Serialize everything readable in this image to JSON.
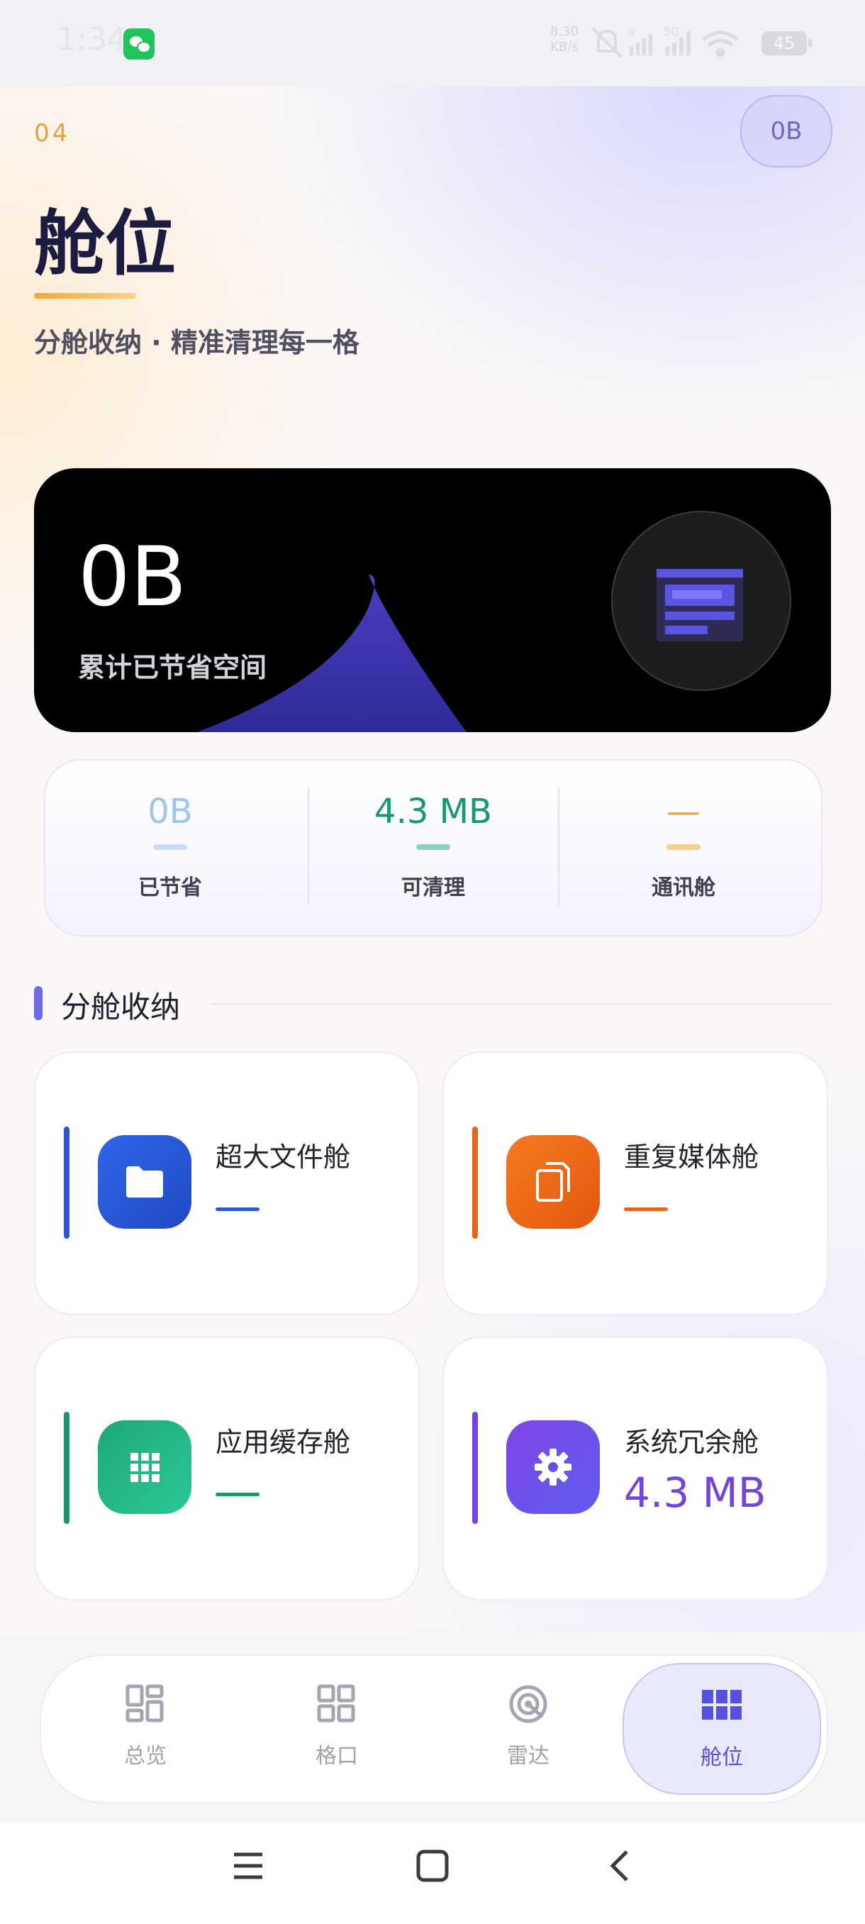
{
  "status_bar": {
    "time": "1:34",
    "net_speed_value": "8.30",
    "net_speed_unit": "KB/s",
    "network_label": "5G",
    "battery": "45"
  },
  "header": {
    "number": "04",
    "badge": "0B",
    "title": "舱位",
    "subtitle": "分舱收纳 · 精准清理每一格"
  },
  "hero": {
    "value": "0B",
    "label": "累计已节省空间"
  },
  "stats": [
    {
      "value": "0B",
      "label": "已节省",
      "color": "#9cc6ee",
      "bar_color": "#c9def6"
    },
    {
      "value": "4.3 MB",
      "label": "可清理",
      "color": "#159a6e",
      "bar_color": "#8fd4b6"
    },
    {
      "value": "—",
      "label": "通讯舱",
      "color": "#f0a73a",
      "bar_color": "#f6cf8a"
    }
  ],
  "section": {
    "title": "分舱收纳"
  },
  "cards": [
    {
      "name": "超大文件舱",
      "value": "—",
      "accent": "#2b56d6",
      "icon": "folder-icon"
    },
    {
      "name": "重复媒体舱",
      "value": "—",
      "accent": "#e8641b",
      "icon": "copy-icon"
    },
    {
      "name": "应用缓存舱",
      "value": "—",
      "accent": "#17976b",
      "icon": "grid-icon"
    },
    {
      "name": "系统冗余舱",
      "value": "4.3 MB",
      "accent": "#7444e0",
      "icon": "gear-icon"
    }
  ],
  "nav": [
    {
      "label": "总览",
      "icon": "dashboard-icon",
      "active": false
    },
    {
      "label": "格口",
      "icon": "grid-icon",
      "active": false
    },
    {
      "label": "雷达",
      "icon": "radar-icon",
      "active": false
    },
    {
      "label": "舱位",
      "icon": "modules-icon",
      "active": true
    }
  ]
}
